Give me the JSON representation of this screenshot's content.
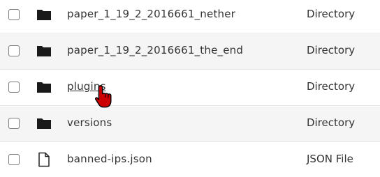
{
  "rows": [
    {
      "name": "paper_1_19_2_2016661_nether",
      "type": "Directory",
      "icon": "folder-icon",
      "checked": false
    },
    {
      "name": "paper_1_19_2_2016661_the_end",
      "type": "Directory",
      "icon": "folder-icon",
      "checked": false
    },
    {
      "name": "plugins",
      "type": "Directory",
      "icon": "folder-icon",
      "checked": false,
      "hovered": true
    },
    {
      "name": "versions",
      "type": "Directory",
      "icon": "folder-icon",
      "checked": false
    },
    {
      "name": "banned-ips.json",
      "type": "JSON File",
      "icon": "file-icon",
      "checked": false
    }
  ],
  "colors": {
    "row_alt_bg": "#f5f5f5",
    "cursor_fill": "#cc0000"
  },
  "cursor": {
    "icon": "hand-pointer-icon"
  }
}
